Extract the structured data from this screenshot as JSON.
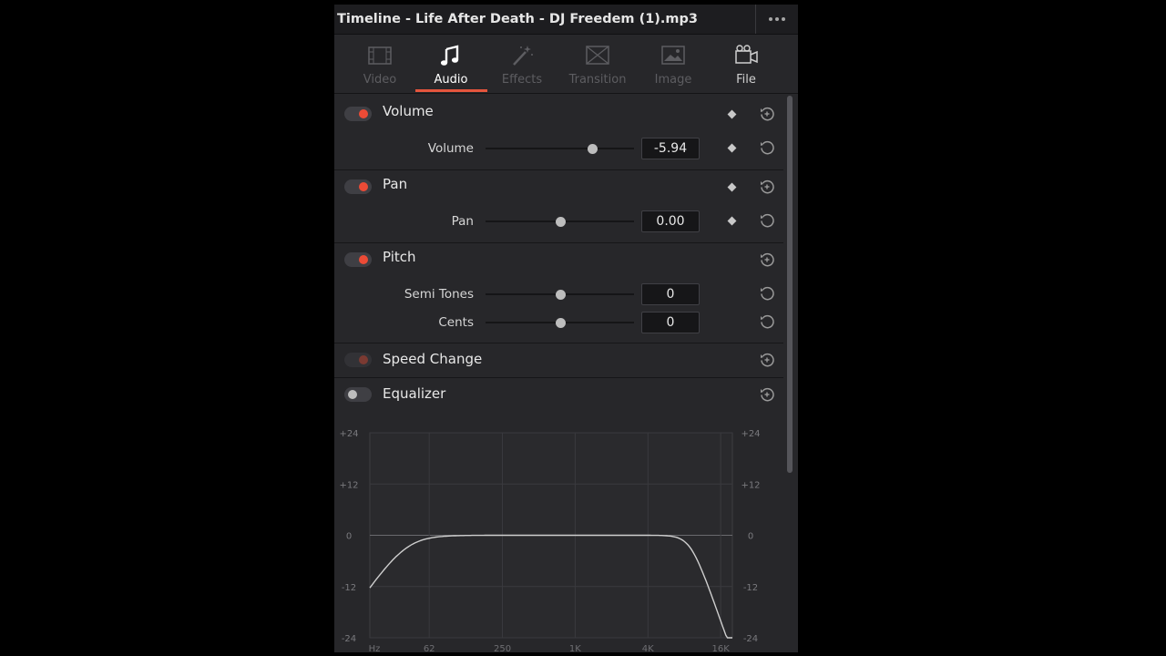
{
  "header": {
    "title": "Timeline - Life After Death - DJ Freedem (1).mp3",
    "more_icon": "ellipsis-icon"
  },
  "tabs": [
    {
      "label": "Video",
      "icon": "film-icon",
      "state": "disabled"
    },
    {
      "label": "Audio",
      "icon": "music-note-icon",
      "state": "active"
    },
    {
      "label": "Effects",
      "icon": "magic-wand-icon",
      "state": "disabled"
    },
    {
      "label": "Transition",
      "icon": "transition-icon",
      "state": "disabled"
    },
    {
      "label": "Image",
      "icon": "image-icon",
      "state": "disabled"
    },
    {
      "label": "File",
      "icon": "film-reel-icon",
      "state": "enabled"
    }
  ],
  "sections": {
    "volume": {
      "title": "Volume",
      "enabled": true,
      "param": {
        "label": "Volume",
        "value": "-5.94",
        "level": 0.72
      }
    },
    "pan": {
      "title": "Pan",
      "enabled": true,
      "param": {
        "label": "Pan",
        "value": "0.00",
        "level": 0.5
      }
    },
    "pitch": {
      "title": "Pitch",
      "enabled": true,
      "params": [
        {
          "label": "Semi Tones",
          "value": "0",
          "level": 0.5
        },
        {
          "label": "Cents",
          "value": "0",
          "level": 0.5
        }
      ]
    },
    "speed_change": {
      "title": "Speed Change",
      "enabled": "dimmed"
    },
    "equalizer": {
      "title": "Equalizer",
      "enabled": false
    }
  },
  "eq": {
    "y_ticks": [
      "+24",
      "+12",
      "0",
      "-12",
      "-24"
    ],
    "y_values": [
      24,
      12,
      0,
      -12,
      -24
    ],
    "x_ticks": [
      "Hz",
      "62",
      "250",
      "1K",
      "4K",
      "16K"
    ],
    "x_values": [
      20,
      62,
      250,
      1000,
      4000,
      16000
    ],
    "x_range": [
      20,
      20000
    ],
    "y_range": [
      -24,
      24
    ],
    "grid": true,
    "curve_color": "#cfcfcf",
    "accent": "#e5553d"
  }
}
